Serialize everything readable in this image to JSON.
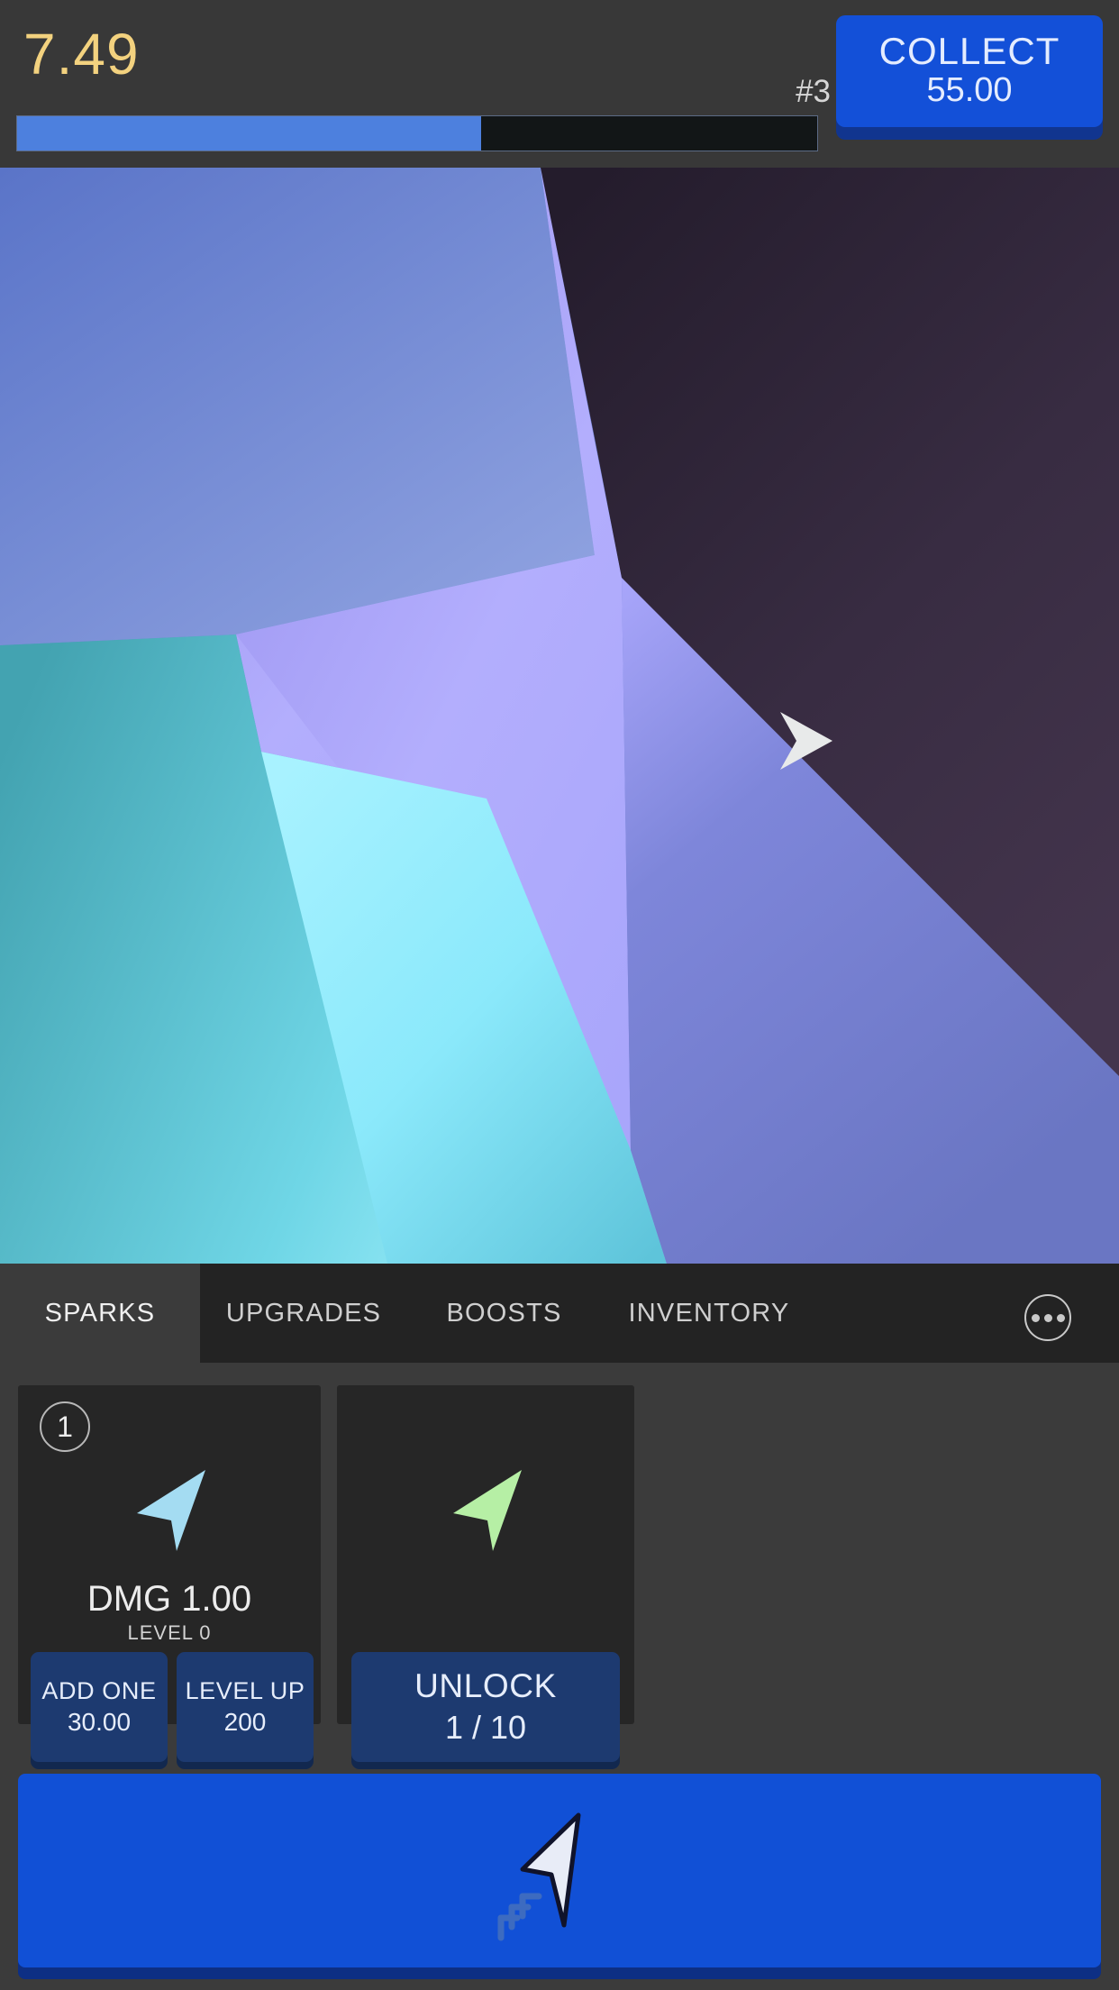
{
  "hud": {
    "score": "7.49",
    "rank": "#3",
    "collect_label": "COLLECT",
    "collect_value": "55.00",
    "progress_percent": 58,
    "progress_fill_color": "#4d80de",
    "progress_track_color": "#121617",
    "score_color": "#f3d27f",
    "collect_color": "#1350d8"
  },
  "canvas": {
    "name": "voronoi-shard-scene",
    "cursor_icon": "arrow-cursor-icon",
    "colors": {
      "top_left_blue": "#5570c4",
      "lavender": "#aaa8fb",
      "dark_plum": "#2e2539",
      "teal": "#45a0ae",
      "bright_cyan": "#9aeeff",
      "periwinkle": "#6a78c6"
    }
  },
  "tabs": {
    "items": [
      {
        "label": "SPARKS",
        "active": true
      },
      {
        "label": "UPGRADES",
        "active": false
      },
      {
        "label": "BOOSTS",
        "active": false
      },
      {
        "label": "INVENTORY",
        "active": false
      }
    ],
    "more_icon": "ellipsis-icon"
  },
  "cards": [
    {
      "badge": "1",
      "art_icon": "blue-arrow-cursor-icon",
      "art_color": "#a4dcf2",
      "title": "DMG 1.00",
      "subtitle": "LEVEL 0",
      "buttons": [
        {
          "label": "ADD ONE",
          "value": "30.00"
        },
        {
          "label": "LEVEL UP",
          "value": "200"
        }
      ]
    },
    {
      "badge": "",
      "art_icon": "green-arrow-cursor-icon",
      "art_color": "#b6efa5",
      "title": "",
      "subtitle": "",
      "buttons": [
        {
          "label": "UNLOCK",
          "value": "1 / 10"
        }
      ]
    }
  ],
  "action_button": {
    "icon": "click-cursor-icon",
    "color": "#1150d6"
  }
}
